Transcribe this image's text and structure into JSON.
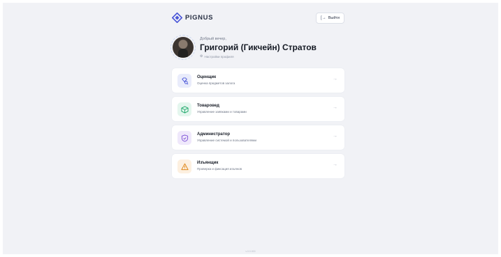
{
  "app": {
    "brand": "PIGNUS"
  },
  "header": {
    "logout_label": "Выйти"
  },
  "profile": {
    "greeting": "Добрый вечер,",
    "name": "Григорий (Гикчейн) Стратов",
    "settings_label": "Настройки профиля"
  },
  "roles": [
    {
      "title": "Оценщик",
      "subtitle": "Оценка предметов залога",
      "icon": "gem-search-icon",
      "color": "#4a56d8",
      "bg": "#e9ecfb"
    },
    {
      "title": "Товаровед",
      "subtitle": "Управление заявками и товарами",
      "icon": "box-icon",
      "color": "#1fa86a",
      "bg": "#e4f6ee"
    },
    {
      "title": "Администратор",
      "subtitle": "Управление системой и пользователями",
      "icon": "shield-check-icon",
      "color": "#7b4fd6",
      "bg": "#efe8fb"
    },
    {
      "title": "Изъянщик",
      "subtitle": "Проверка и фиксация изъянов",
      "icon": "warning-icon",
      "color": "#e08a1e",
      "bg": "#fdf0e0"
    }
  ],
  "footer": {
    "version": "v.0.0.000"
  },
  "colors": {
    "accent": "#4a56d8",
    "background": "#f1f2f6"
  }
}
